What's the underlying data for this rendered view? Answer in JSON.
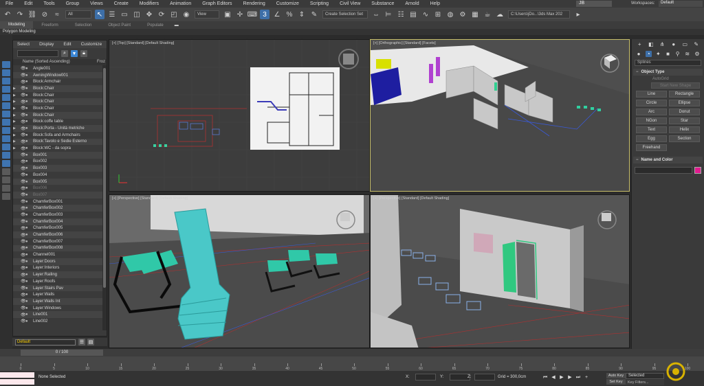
{
  "menubar": {
    "items": [
      "File",
      "Edit",
      "Tools",
      "Group",
      "Views",
      "Create",
      "Modifiers",
      "Animation",
      "Graph Editors",
      "Rendering",
      "Customize",
      "Scripting",
      "Civil View",
      "Substance",
      "Arnold",
      "Help"
    ],
    "user": "JB",
    "workspaces_label": "Workspaces:",
    "workspace_value": "Default"
  },
  "toolbar": {
    "filter_value": "All",
    "view_value": "View",
    "selection_set": "Create Selection Set",
    "path": "C:\\Users\\jDo...\\3ds Max 202"
  },
  "ribbon": {
    "tabs": [
      "Modeling",
      "Freeform",
      "Selection",
      "Object Paint",
      "Populate"
    ],
    "sub_label": "Polygon Modeling"
  },
  "explorer": {
    "menu": [
      "Select",
      "Display",
      "Edit",
      "Customize"
    ],
    "column_name": "Name (Sorted Ascending)",
    "column_prop": "Froz",
    "objects": [
      {
        "name": "Angle001",
        "dim": false,
        "expand": false
      },
      {
        "name": "AwningWindow001",
        "dim": false,
        "expand": false
      },
      {
        "name": "Block:Armchair",
        "dim": false,
        "expand": false
      },
      {
        "name": "Block:Chair",
        "dim": false,
        "expand": true
      },
      {
        "name": "Block:Chair",
        "dim": false,
        "expand": true
      },
      {
        "name": "Block:Chair",
        "dim": false,
        "expand": true
      },
      {
        "name": "Block:Chair",
        "dim": false,
        "expand": true
      },
      {
        "name": "Block:Chair",
        "dim": false,
        "expand": true
      },
      {
        "name": "Block:coffe table",
        "dim": false,
        "expand": true
      },
      {
        "name": "Block:Porta - Unità metriche",
        "dim": false,
        "expand": true
      },
      {
        "name": "Block:Sofa and Armchairs",
        "dim": false,
        "expand": true
      },
      {
        "name": "Block:Tavolo e Sedie Esterno",
        "dim": false,
        "expand": true
      },
      {
        "name": "Block:WC - da sopra",
        "dim": false,
        "expand": true
      },
      {
        "name": "Box001",
        "dim": false,
        "expand": false
      },
      {
        "name": "Box002",
        "dim": false,
        "expand": false
      },
      {
        "name": "Box003",
        "dim": false,
        "expand": false
      },
      {
        "name": "Box004",
        "dim": false,
        "expand": false
      },
      {
        "name": "Box005",
        "dim": false,
        "expand": false
      },
      {
        "name": "Box006",
        "dim": true,
        "expand": false
      },
      {
        "name": "Box007",
        "dim": true,
        "expand": false
      },
      {
        "name": "ChamferBox001",
        "dim": false,
        "expand": false
      },
      {
        "name": "ChamferBox002",
        "dim": false,
        "expand": false
      },
      {
        "name": "ChamferBox003",
        "dim": false,
        "expand": false
      },
      {
        "name": "ChamferBox004",
        "dim": false,
        "expand": false
      },
      {
        "name": "ChamferBox005",
        "dim": false,
        "expand": false
      },
      {
        "name": "ChamferBox006",
        "dim": false,
        "expand": false
      },
      {
        "name": "ChamferBox007",
        "dim": false,
        "expand": false
      },
      {
        "name": "ChamferBox008",
        "dim": false,
        "expand": false
      },
      {
        "name": "Channel001",
        "dim": false,
        "expand": false
      },
      {
        "name": "Layer:Doors",
        "dim": false,
        "expand": false
      },
      {
        "name": "Layer:Interiors",
        "dim": false,
        "expand": false
      },
      {
        "name": "Layer:Railing",
        "dim": false,
        "expand": false
      },
      {
        "name": "Layer:Roofs",
        "dim": false,
        "expand": false
      },
      {
        "name": "Layer:Stairs Pav",
        "dim": false,
        "expand": false
      },
      {
        "name": "Layer:Walls",
        "dim": false,
        "expand": false
      },
      {
        "name": "Layer:Walls Int",
        "dim": false,
        "expand": false
      },
      {
        "name": "Layer:Windows",
        "dim": false,
        "expand": false
      },
      {
        "name": "Line001",
        "dim": false,
        "expand": false
      },
      {
        "name": "Line002",
        "dim": false,
        "expand": false
      }
    ],
    "layer_value": "Default"
  },
  "viewports": {
    "top_label": "[+] [Top] [Standard] [Default Shading]",
    "ortho_label": "[+] [Orthographic] [Standard] [Facets]",
    "persp1_label": "[+] [Perspective] [Standard] [Default Shading]",
    "persp2_label": "[+] [Perspective] [Standard] [Default Shading]"
  },
  "command_panel": {
    "category": "Splines",
    "object_type_title": "Object Type",
    "autogrid": "AutoGrid",
    "start_new_shape": "Start New Shape",
    "shapes": [
      "Line",
      "Rectangle",
      "Circle",
      "Ellipse",
      "Arc",
      "Donut",
      "NGon",
      "Star",
      "Text",
      "Helix",
      "Egg",
      "Section",
      "Freehand"
    ],
    "name_color_title": "Name and Color",
    "swatch_color": "#e01b8e"
  },
  "timeline": {
    "frame_label": "0 / 100",
    "ticks": [
      0,
      5,
      10,
      15,
      20,
      25,
      30,
      35,
      40,
      45,
      50,
      55,
      60,
      65,
      70,
      75,
      80,
      85,
      90,
      95,
      100
    ]
  },
  "status": {
    "text": "None Selected",
    "x_label": "X:",
    "y_label": "Y:",
    "z_label": "Z:",
    "grid": "Grid = 300,0cm",
    "autokey": "Auto Key",
    "setkey": "Set Key",
    "selected": "Selected",
    "keyfilters": "Key Filters..."
  }
}
